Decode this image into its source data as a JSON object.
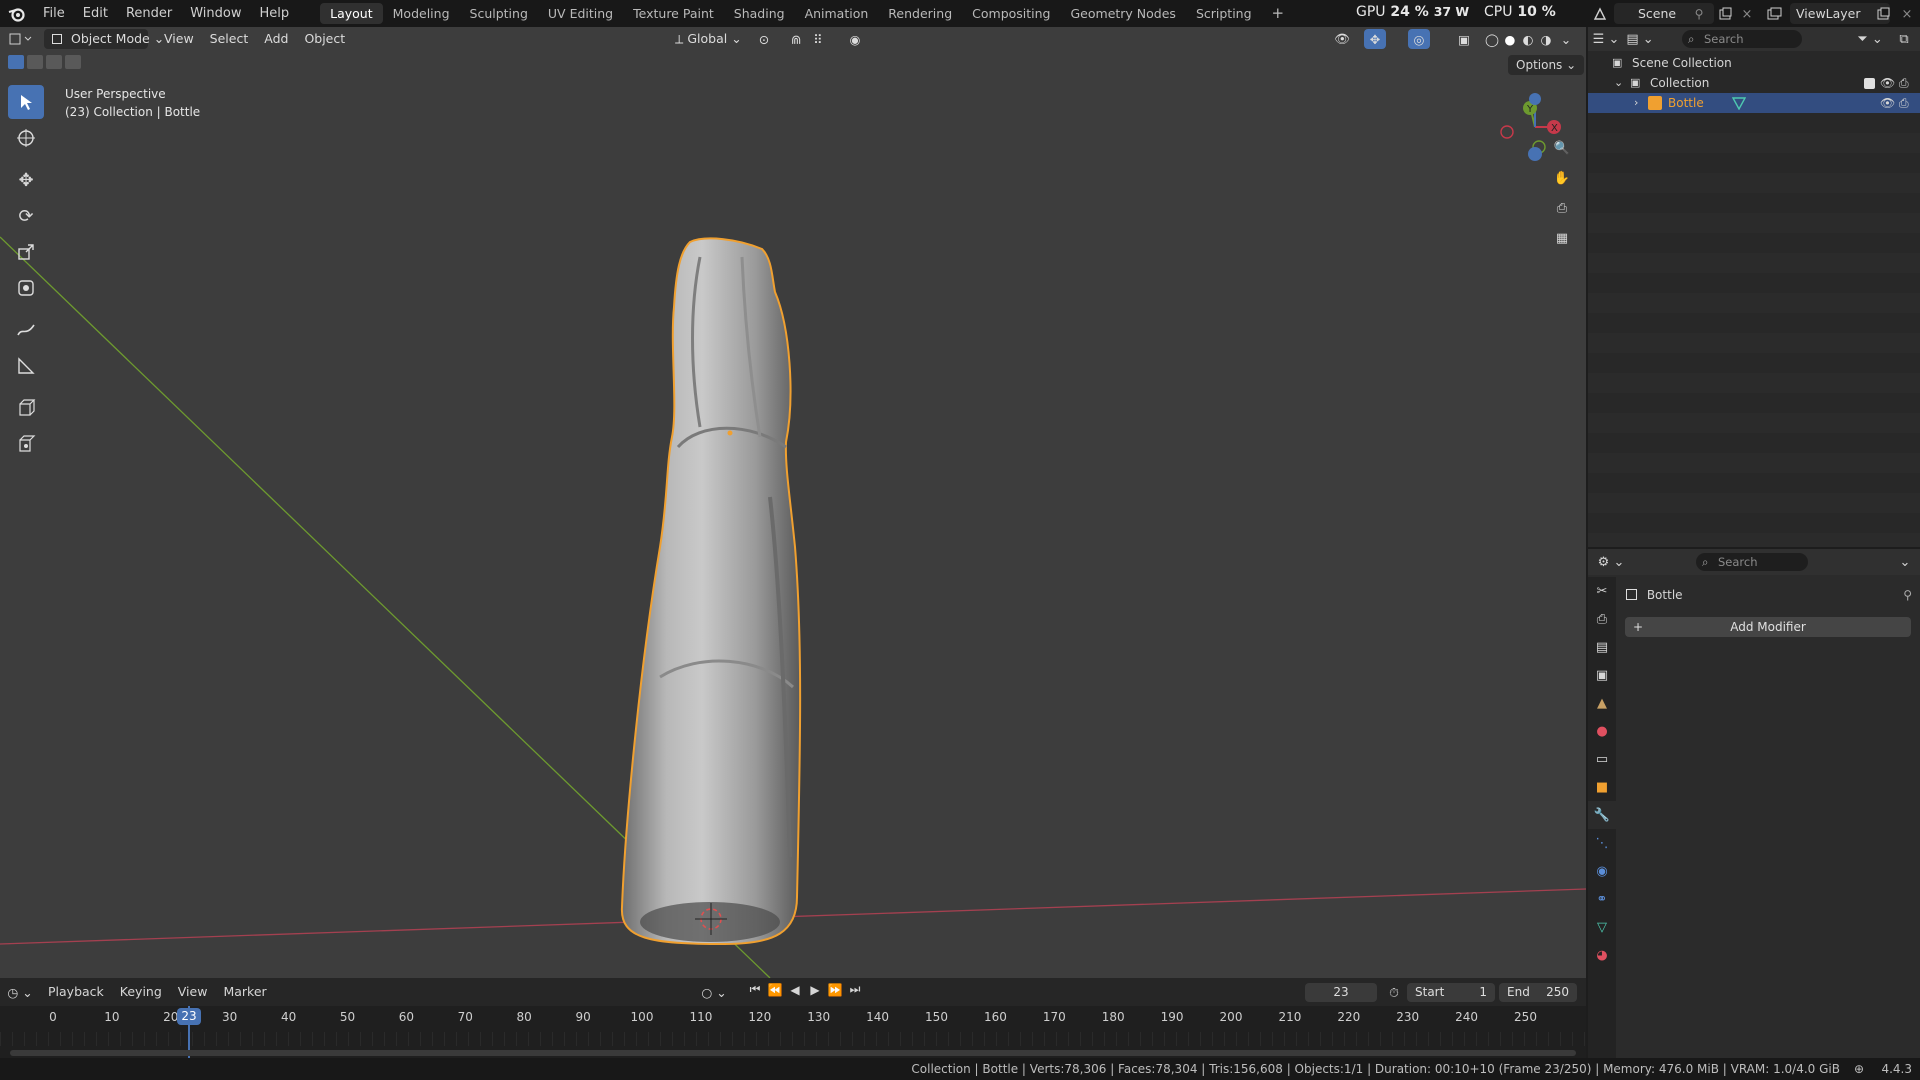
{
  "menu": {
    "items": [
      "File",
      "Edit",
      "Render",
      "Window",
      "Help"
    ]
  },
  "workspaces": {
    "tabs": [
      "Layout",
      "Modeling",
      "Sculpting",
      "UV Editing",
      "Texture Paint",
      "Shading",
      "Animation",
      "Rendering",
      "Compositing",
      "Geometry Nodes",
      "Scripting"
    ],
    "active": "Layout",
    "add": "+"
  },
  "perf": {
    "gpu_label": "GPU",
    "gpu_value": "24 %",
    "gpu_power": "37 W",
    "cpu_label": "CPU",
    "cpu_value": "10 %"
  },
  "scene": {
    "name": "Scene",
    "view_layer": "ViewLayer"
  },
  "viewport": {
    "mode": "Object Mode",
    "menus": [
      "View",
      "Select",
      "Add",
      "Object"
    ],
    "orientation": "Global",
    "options_label": "Options",
    "perspective": "User Perspective",
    "context": "(23) Collection | Bottle",
    "gizmo": {
      "x": "X",
      "y": "Y",
      "z": "Z"
    }
  },
  "timeline": {
    "menus": [
      "Playback",
      "Keying",
      "View",
      "Marker"
    ],
    "current_frame": "23",
    "start_label": "Start",
    "start": "1",
    "end_label": "End",
    "end": "250",
    "ticks": [
      "0",
      "10",
      "20",
      "30",
      "40",
      "50",
      "60",
      "70",
      "80",
      "90",
      "100",
      "110",
      "120",
      "130",
      "140",
      "150",
      "160",
      "170",
      "180",
      "190",
      "200",
      "210",
      "220",
      "230",
      "240",
      "250"
    ]
  },
  "outliner": {
    "search_placeholder": "Search",
    "scene_collection": "Scene Collection",
    "collection": "Collection",
    "object": "Bottle"
  },
  "properties": {
    "search_placeholder": "Search",
    "object_name": "Bottle",
    "add_modifier": "Add Modifier"
  },
  "status": {
    "text": "Collection | Bottle | Verts:78,306 | Faces:78,304 | Tris:156,608 | Objects:1/1 | Duration: 00:10+10 (Frame 23/250) | Memory: 476.0 MiB | VRAM: 1.0/4.0 GiB",
    "version": "4.4.3"
  },
  "colors": {
    "accent": "#4772b3",
    "selection": "#f0a030",
    "x_axis": "#c6394a",
    "y_axis": "#6d9a2f"
  }
}
